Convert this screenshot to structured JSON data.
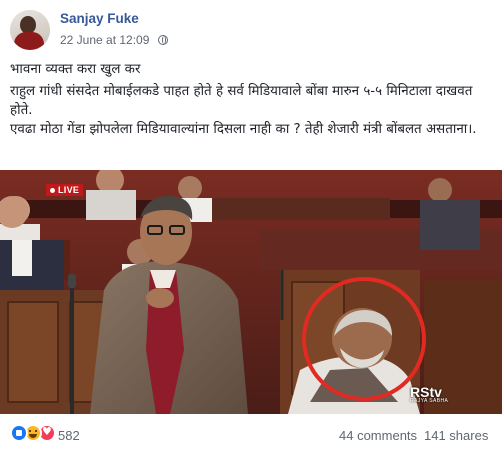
{
  "post": {
    "author": "Sanjay Fuke",
    "timestamp": "22 June at 12:09",
    "privacy_icon": "globe-icon",
    "text_lines": [
      "भावना व्यक्त करा खुल कर",
      "राहुल गांधी संसदेत मोबाईलकडे पाहत होते हे सर्व मिडियावाले बोंबा मारुन ५-५ मिनिटाला दाखवत होते.",
      "एवढा मोठा गेंडा झोपलेला मिडियावाल्यांना दिसला नाही का ? तेही शेजारी मंत्री बोंबलत असताना।."
    ]
  },
  "photo": {
    "live_label": "LIVE",
    "channel_logo": "RStv",
    "channel_subtitle": "RAJYA SABHA",
    "highlight_color": "#e02a22"
  },
  "footer": {
    "reaction_icons": [
      "like-icon",
      "haha-icon",
      "love-icon"
    ],
    "reaction_count": "582",
    "comments": "44 comments",
    "shares": "141 shares"
  }
}
